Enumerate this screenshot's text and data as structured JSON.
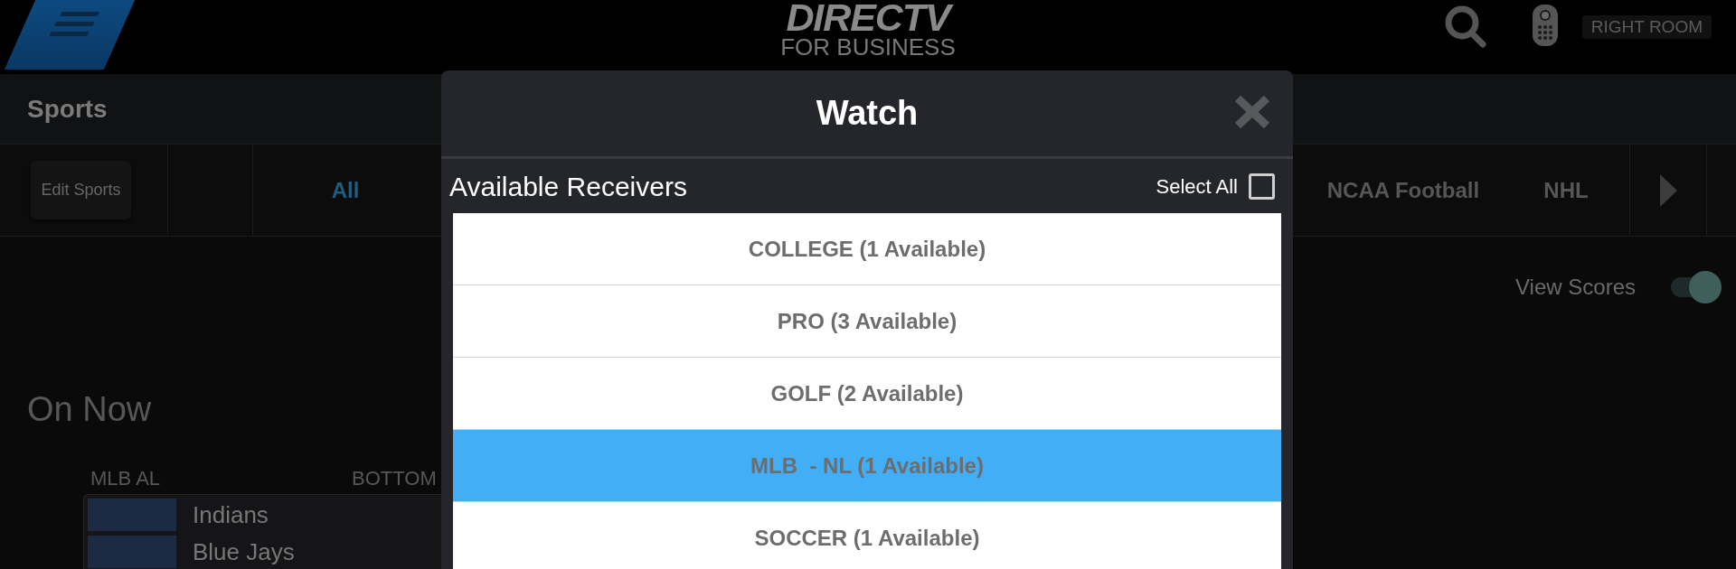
{
  "top_bar": {
    "logo": {
      "wordmark": "DIRECTV",
      "tagline": "FOR BUSINESS"
    },
    "room": "RIGHT ROOM"
  },
  "section": {
    "title": "Sports"
  },
  "sport_tabs": {
    "edit_button": "Edit Sports",
    "tabs": [
      {
        "label": "All",
        "selected": true
      },
      {
        "label": "NCAA Football",
        "selected": false
      },
      {
        "label": "NHL",
        "selected": false
      }
    ]
  },
  "view_scores": {
    "label": "View Scores",
    "on": true
  },
  "on_now": {
    "title": "On Now",
    "game": {
      "league": "MLB AL",
      "status": "BOTTOM",
      "teams": [
        {
          "name": "Indians"
        },
        {
          "name": "Blue Jays"
        }
      ]
    }
  },
  "modal": {
    "title": "Watch",
    "subtitle": "Available Receivers",
    "select_all": {
      "label": "Select All",
      "checked": false
    },
    "receivers": [
      {
        "label": "COLLEGE (1 Available)",
        "selected": false
      },
      {
        "label": "PRO (3 Available)",
        "selected": false
      },
      {
        "label": "GOLF (2 Available)",
        "selected": false
      },
      {
        "label": "MLB  - NL (1 Available)",
        "selected": true
      },
      {
        "label": "SOCCER (1 Available)",
        "selected": false
      }
    ]
  }
}
